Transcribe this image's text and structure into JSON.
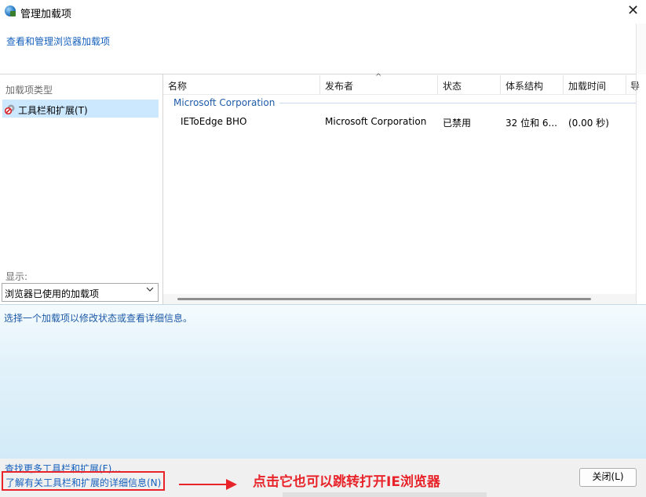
{
  "window": {
    "title": "管理加载项",
    "close_glyph": "✕"
  },
  "header": {
    "link": "查看和管理浏览器加载项"
  },
  "left_pane": {
    "types_label": "加载项类型",
    "items": [
      {
        "label": "工具栏和扩展(T)",
        "icon": "gear-blocked-icon",
        "selected": true
      }
    ],
    "show_label": "显示:",
    "show_select": {
      "value": "浏览器已使用的加载项"
    }
  },
  "list": {
    "columns": [
      "名称",
      "发布者",
      "状态",
      "体系结构",
      "加载时间",
      "导"
    ],
    "sort_glyph": "^",
    "groups": [
      {
        "name": "Microsoft Corporation",
        "rows": [
          {
            "name": "IEToEdge BHO",
            "publisher": "Microsoft Corporation",
            "status": "已禁用",
            "arch": "32 位和 6...",
            "load_time": "(0.00 秒)"
          }
        ]
      }
    ]
  },
  "details": {
    "hint": "选择一个加载项以修改状态或查看详细信息。"
  },
  "footer": {
    "find_more": "查找更多工具栏和扩展(F)...",
    "learn_more": "了解有关工具栏和扩展的详细信息(N)",
    "close_label": "关闭(L)"
  },
  "annotation": {
    "text": "点击它也可以跳转打开IE浏览器",
    "color": "#e8232a"
  },
  "colors": {
    "link": "#1560bd",
    "selection": "#cce8ff",
    "group": "#1e5aa8"
  }
}
